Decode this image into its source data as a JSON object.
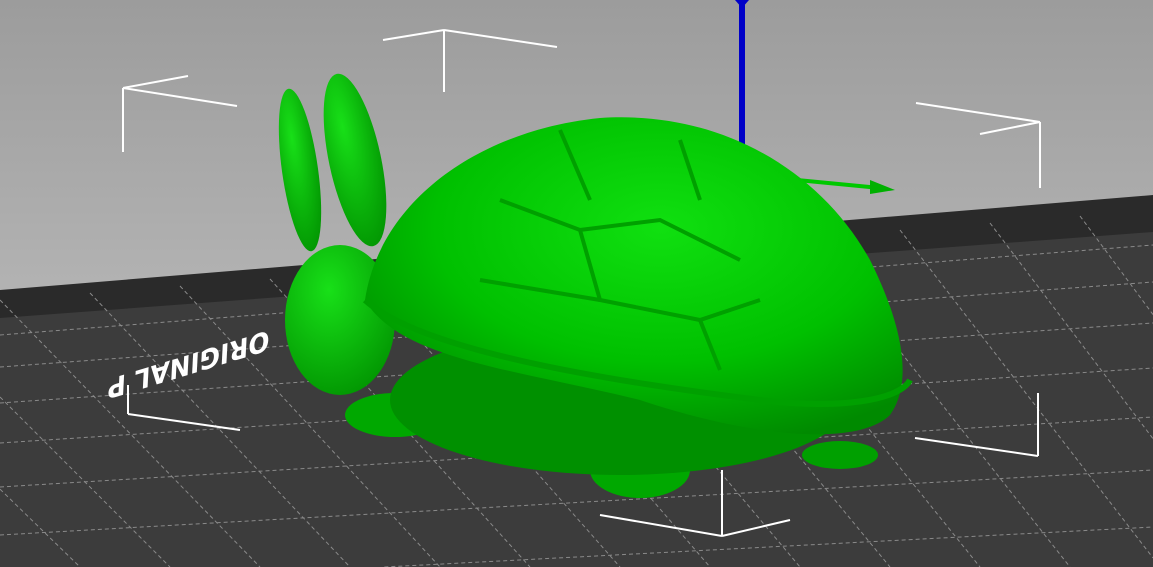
{
  "viewport": {
    "bed_label": "ORIGINAL P",
    "model_color": "#00c800",
    "bed_color": "#3a3a3a",
    "background_top": "#9c9c9c",
    "background_bottom": "#c4c4c4",
    "axis_z_color": "#0000c8",
    "axis_y_color": "#00c800"
  }
}
